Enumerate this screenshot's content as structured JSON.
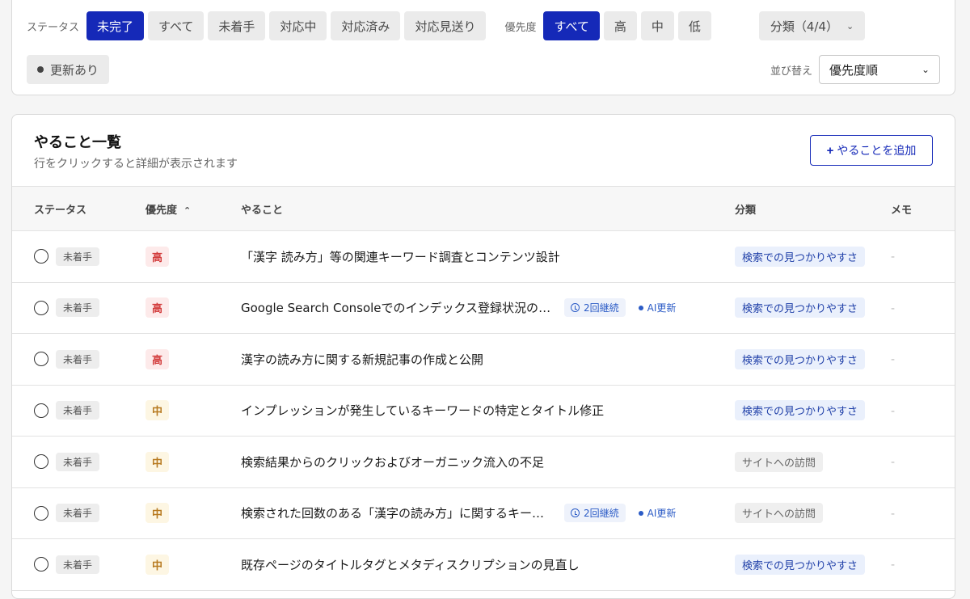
{
  "filters": {
    "status_label": "ステータス",
    "status_chips": [
      {
        "label": "未完了",
        "active": true
      },
      {
        "label": "すべて",
        "active": false
      },
      {
        "label": "未着手",
        "active": false
      },
      {
        "label": "対応中",
        "active": false
      },
      {
        "label": "対応済み",
        "active": false
      },
      {
        "label": "対応見送り",
        "active": false
      }
    ],
    "priority_label": "優先度",
    "priority_chips": [
      {
        "label": "すべて",
        "active": true
      },
      {
        "label": "高",
        "active": false
      },
      {
        "label": "中",
        "active": false
      },
      {
        "label": "低",
        "active": false
      }
    ],
    "category_dropdown": "分類（4/4）",
    "updated_chip": "更新あり",
    "sort_label": "並び替え",
    "sort_value": "優先度順"
  },
  "list": {
    "title": "やること一覧",
    "subtitle": "行をクリックすると詳細が表示されます",
    "add_button": "やることを追加",
    "columns": {
      "status": "ステータス",
      "priority": "優先度",
      "task": "やること",
      "category": "分類",
      "memo": "メモ"
    },
    "rows": [
      {
        "status": "未着手",
        "priority": "高",
        "task": "「漢字 読み方」等の関連キーワード調査とコンテンツ設計",
        "cont": "",
        "ai": "",
        "category": "検索での見つかりやすさ",
        "memo": "-"
      },
      {
        "status": "未着手",
        "priority": "高",
        "task": "Google Search Consoleでのインデックス登録状況の確認",
        "cont": "2回継続",
        "ai": "AI更新",
        "category": "検索での見つかりやすさ",
        "memo": "-"
      },
      {
        "status": "未着手",
        "priority": "高",
        "task": "漢字の読み方に関する新規記事の作成と公開",
        "cont": "",
        "ai": "",
        "category": "検索での見つかりやすさ",
        "memo": "-"
      },
      {
        "status": "未着手",
        "priority": "中",
        "task": "インプレッションが発生しているキーワードの特定とタイトル修正",
        "cont": "",
        "ai": "",
        "category": "検索での見つかりやすさ",
        "memo": "-"
      },
      {
        "status": "未着手",
        "priority": "中",
        "task": "検索結果からのクリックおよびオーガニック流入の不足",
        "cont": "",
        "ai": "",
        "category": "サイトへの訪問",
        "memo": "-"
      },
      {
        "status": "未着手",
        "priority": "中",
        "task": "検索された回数のある「漢字の読み方」に関するキーワード",
        "cont": "2回継続",
        "ai": "AI更新",
        "category": "サイトへの訪問",
        "memo": "-"
      },
      {
        "status": "未着手",
        "priority": "中",
        "task": "既存ページのタイトルタグとメタディスクリプションの見直し",
        "cont": "",
        "ai": "",
        "category": "検索での見つかりやすさ",
        "memo": "-"
      }
    ]
  },
  "colors": {
    "accent": "#1529b8",
    "priority_high": "#d23a3a",
    "priority_mid": "#b7791f",
    "category_search": "#1f3fa8"
  }
}
